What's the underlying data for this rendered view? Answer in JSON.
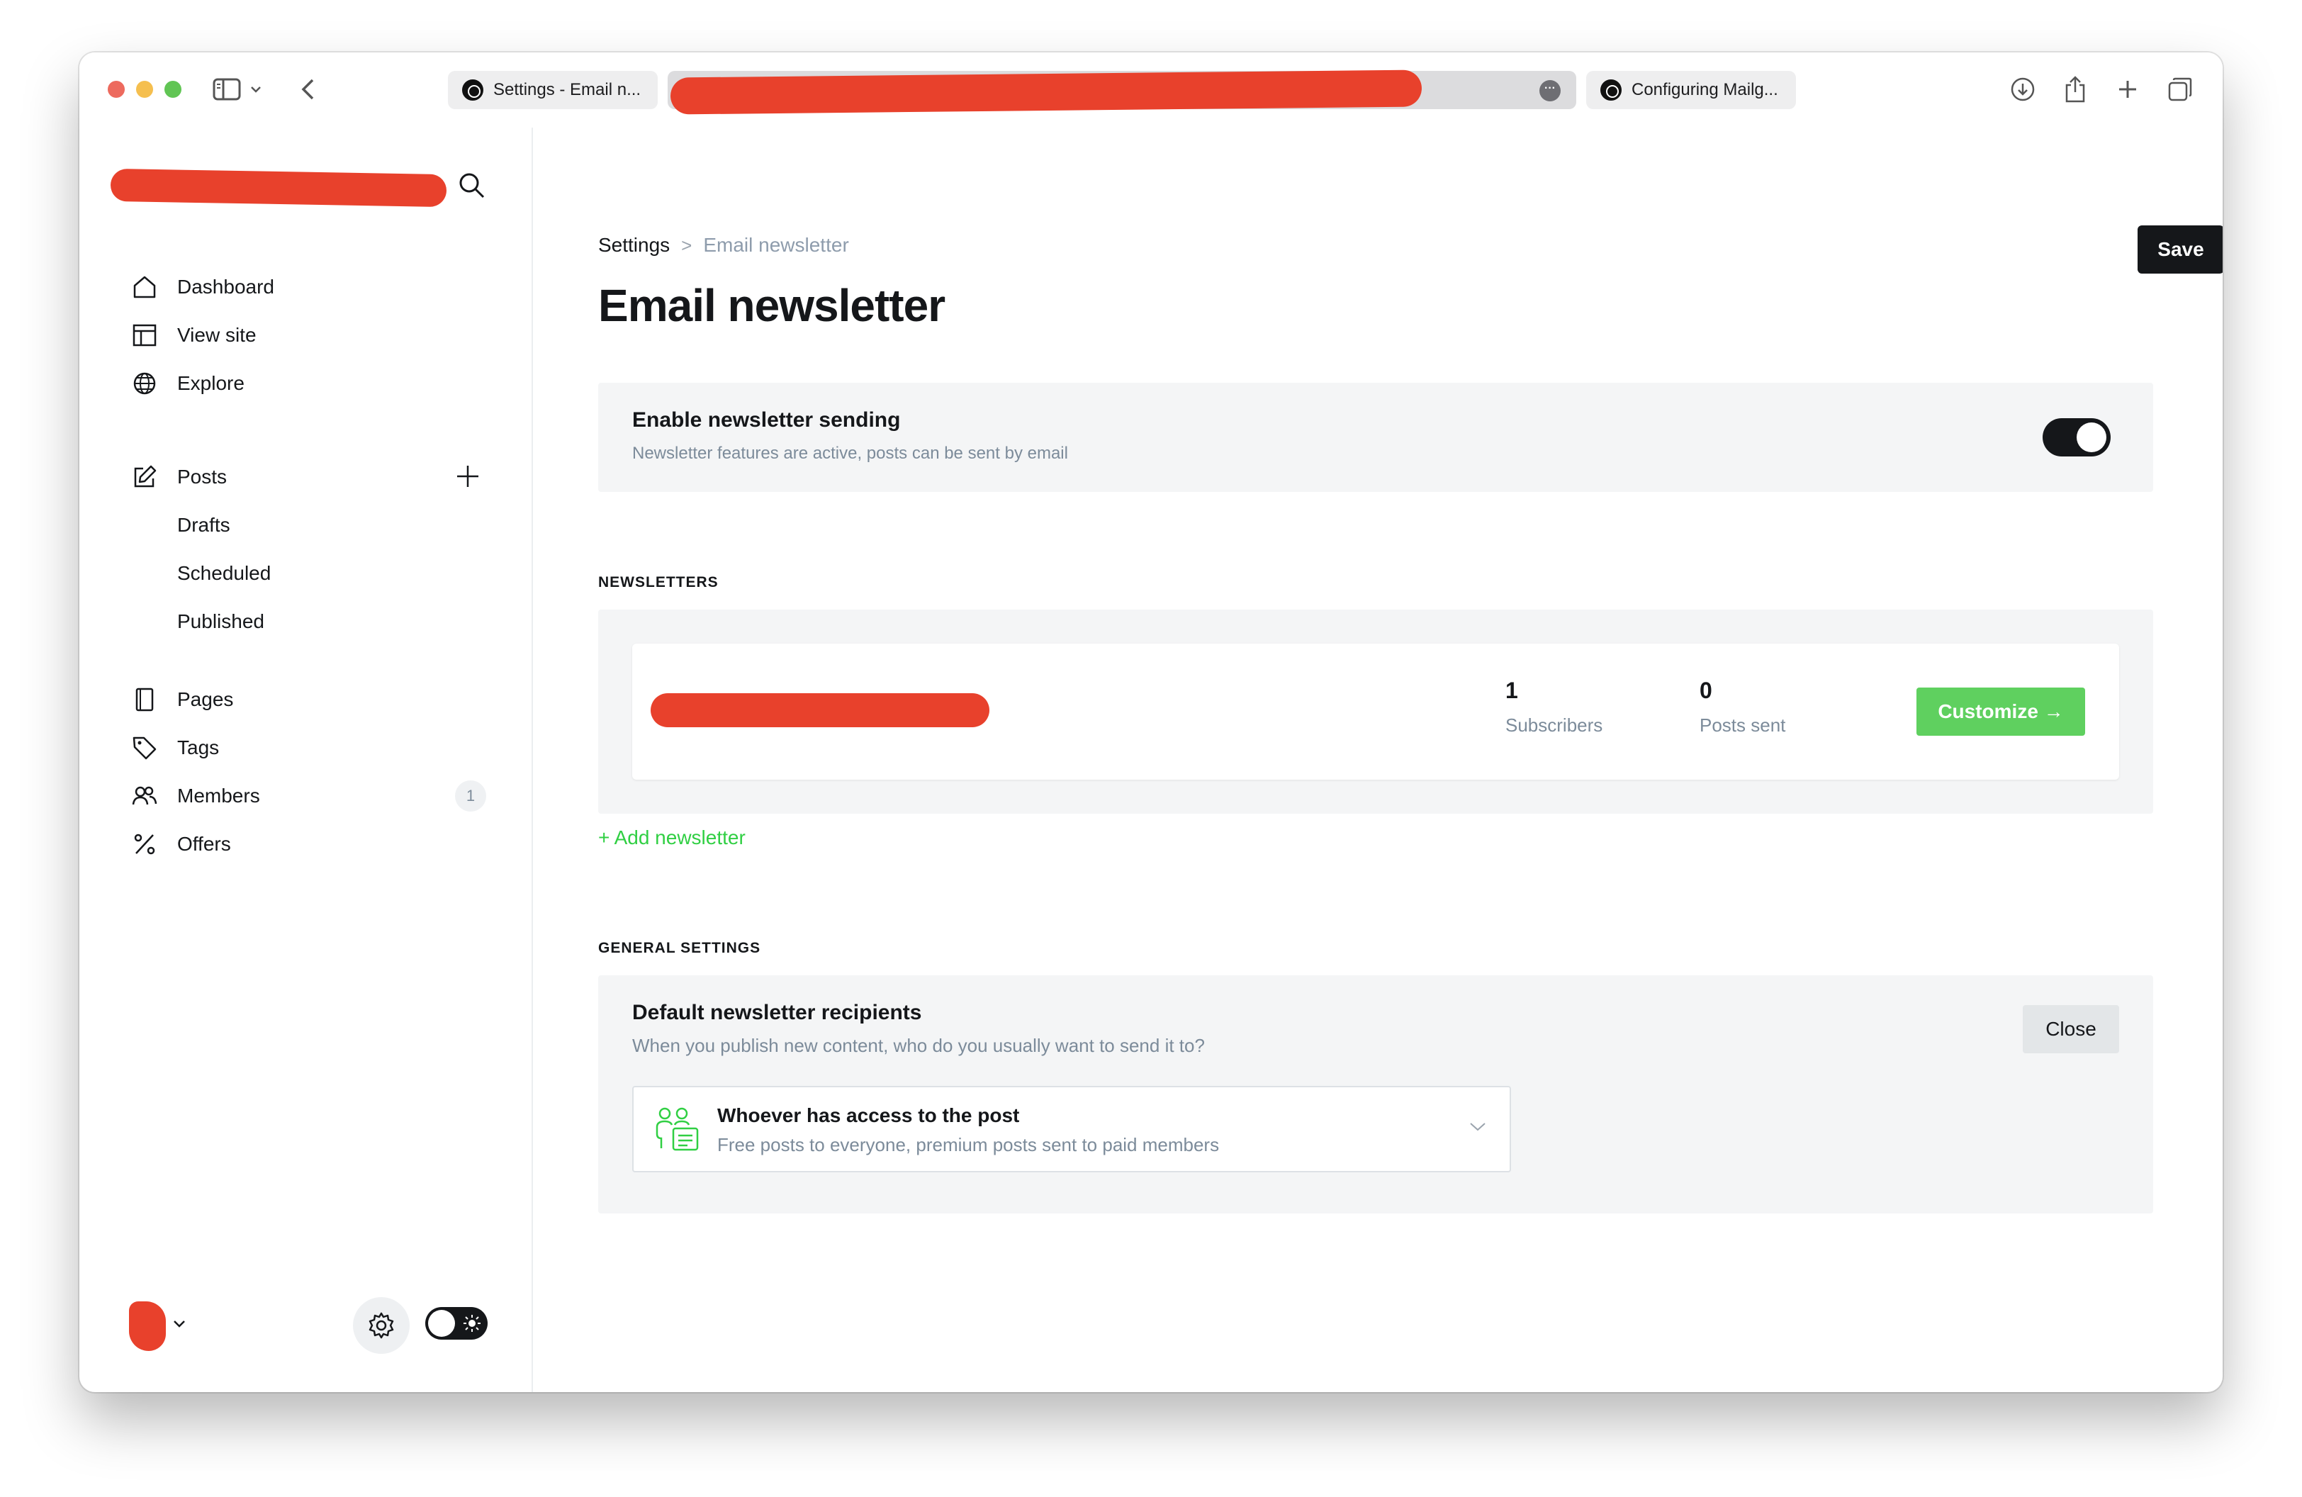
{
  "browser": {
    "tabs": [
      {
        "label": "Settings - Email n..."
      },
      {
        "label": ""
      },
      {
        "label": "Configuring Mailg..."
      }
    ]
  },
  "sidebar": {
    "nav_top": [
      {
        "label": "Dashboard",
        "icon": "home-icon"
      },
      {
        "label": "View site",
        "icon": "layout-icon"
      },
      {
        "label": "Explore",
        "icon": "globe-icon"
      }
    ],
    "posts": {
      "label": "Posts",
      "icon": "pencil-icon"
    },
    "post_subs": [
      "Drafts",
      "Scheduled",
      "Published"
    ],
    "nav_bottom": [
      {
        "label": "Pages",
        "icon": "page-icon"
      },
      {
        "label": "Tags",
        "icon": "tag-icon"
      },
      {
        "label": "Members",
        "icon": "members-icon",
        "badge": "1"
      },
      {
        "label": "Offers",
        "icon": "percent-icon"
      }
    ]
  },
  "breadcrumb": {
    "parent": "Settings",
    "separator": ">",
    "current": "Email newsletter"
  },
  "page_title": "Email newsletter",
  "save_label": "Save",
  "enable": {
    "title": "Enable newsletter sending",
    "description": "Newsletter features are active, posts can be sent by email",
    "enabled": true
  },
  "newsletters": {
    "heading": "NEWSLETTERS",
    "items": [
      {
        "subscribers": "1",
        "subscribers_label": "Subscribers",
        "posts_sent": "0",
        "posts_sent_label": "Posts sent",
        "customize_label": "Customize →"
      }
    ],
    "add_label": "+ Add newsletter"
  },
  "general": {
    "heading": "GENERAL SETTINGS",
    "recipients_title": "Default newsletter recipients",
    "recipients_desc": "When you publish new content, who do you usually want to send it to?",
    "close_label": "Close",
    "selected_option": {
      "title": "Whoever has access to the post",
      "desc": "Free posts to everyone, premium posts sent to paid members"
    }
  },
  "colors": {
    "accent_green": "#30cf43",
    "button_green": "#5fd05f",
    "dark": "#15171a",
    "muted": "#7c8b9a",
    "redaction": "#e8412c"
  }
}
